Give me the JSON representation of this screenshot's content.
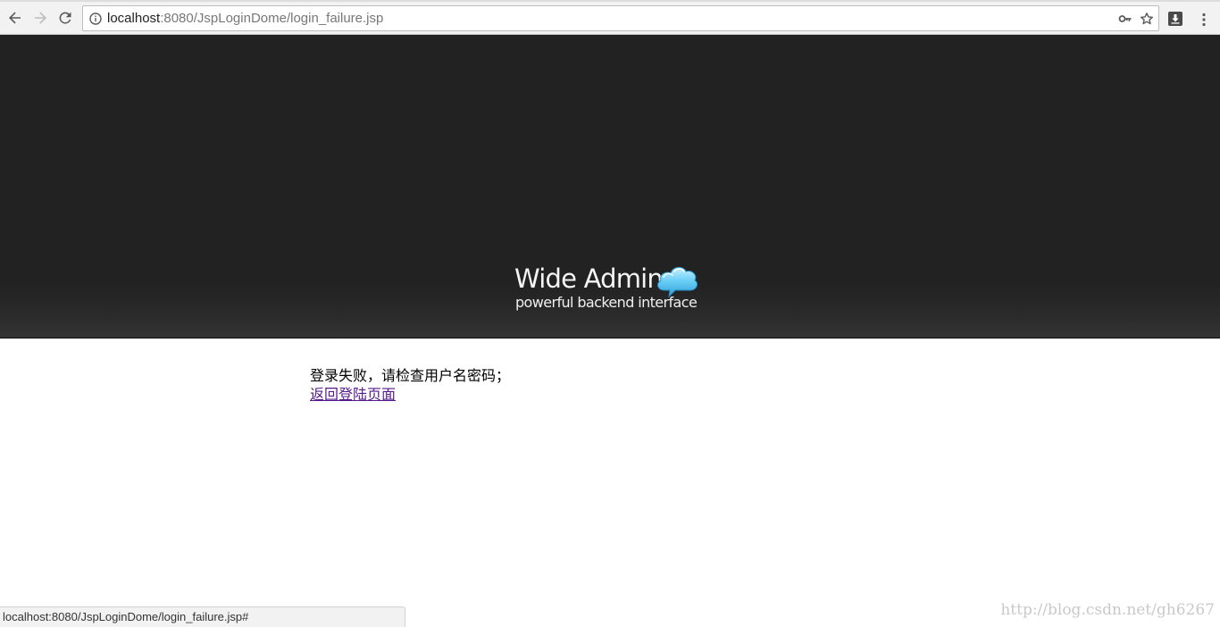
{
  "browser": {
    "address_bar": {
      "host": "localhost",
      "path_rest": ":8080/JspLoginDome/login_failure.jsp"
    },
    "status_bubble": "localhost:8080/JspLoginDome/login_failure.jsp#",
    "icons": {
      "back": "arrow-left-icon",
      "forward": "arrow-right-icon",
      "reload": "reload-icon",
      "site_info": "info-circle-icon",
      "saved_password": "key-icon",
      "bookmark": "star-outline-icon",
      "extension": "download-extension-icon",
      "menu": "vertical-dots-icon"
    }
  },
  "header": {
    "logo_title": "Wide Admin",
    "logo_subtitle": "powerful backend interface",
    "logo_icon": "cloud-icon",
    "colors": {
      "background": "#222222",
      "text": "#f4f4f4",
      "cloud": "#5cc3ee"
    }
  },
  "content": {
    "message": "登录失败，请检查用户名密码；",
    "back_link": "返回登陆页面",
    "link_color": "#551a8b"
  },
  "watermark": "http://blog.csdn.net/gh6267"
}
